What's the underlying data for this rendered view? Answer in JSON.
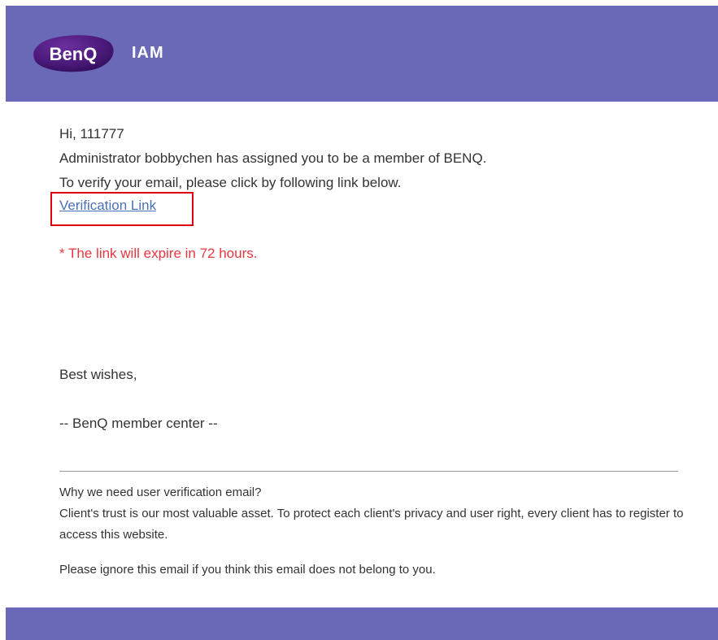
{
  "colors": {
    "header_bg": "#6a69b8",
    "footer_bg": "#6a69b8",
    "link": "#4a72b8",
    "expire_text": "#e8363f",
    "highlight_box": "#e0000e",
    "body_text": "#333333"
  },
  "header": {
    "logo_text": "BenQ",
    "app_name": "IAM"
  },
  "email": {
    "greeting": "Hi, 111777",
    "assignment": "Administrator bobbychen has assigned you to be a member of BENQ.",
    "instruction": "To verify your email, please click by following link below.",
    "link_label": "Verification Link",
    "expire_notice": "* The link will expire in 72 hours.",
    "closing": "Best wishes,",
    "signature": "-- BenQ member center --"
  },
  "footer_note": {
    "question": "Why we need user verification email?",
    "explanation": "Client's trust is our most valuable asset. To protect each client's privacy and user right, every client has to register to access this website.",
    "ignore": "Please ignore this email if you think this email does not belong to you."
  }
}
